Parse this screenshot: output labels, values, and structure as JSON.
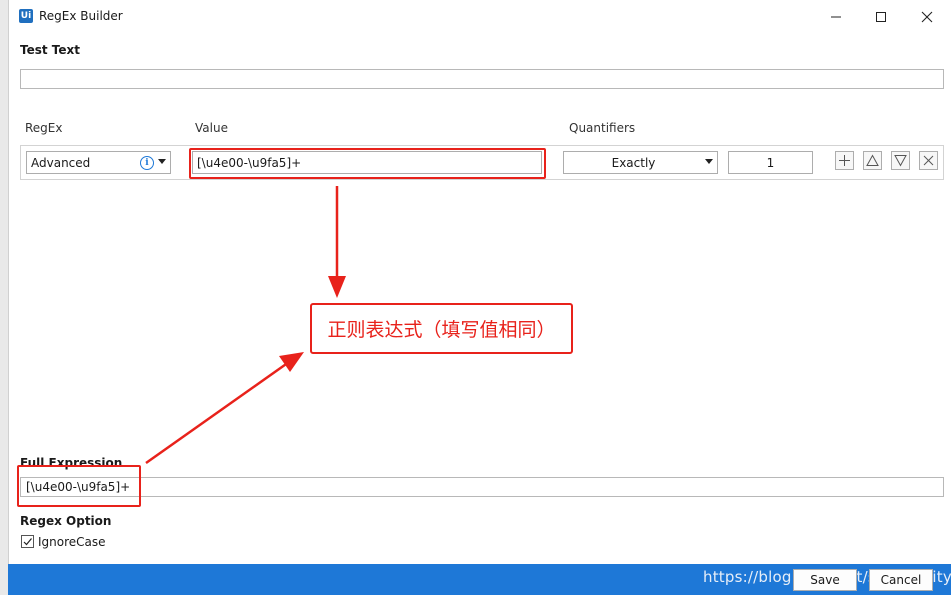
{
  "window": {
    "title": "RegEx Builder",
    "app_icon": "Ui"
  },
  "test_text": {
    "label": "Test Text",
    "value": ""
  },
  "columns": {
    "regex": "RegEx",
    "value": "Value",
    "quantifiers": "Quantifiers"
  },
  "row": {
    "regex_type": "Advanced",
    "value": "[\\u4e00-\\u9fa5]+",
    "quantifier": "Exactly",
    "count": "1"
  },
  "annotation": {
    "text": "正则表达式（填写值相同）",
    "color": "#e8221b"
  },
  "full_expression": {
    "label": "Full Expression",
    "value": "[\\u4e00-\\u9fa5]+"
  },
  "regex_option": {
    "label": "Regex Option",
    "ignore_case_label": "IgnoreCase",
    "ignore_case_checked": true
  },
  "footer": {
    "save_label": "Save",
    "cancel_label": "Cancel",
    "watermark": "https://blog.csdn.net/sinat_...lity"
  },
  "colors": {
    "accent": "#1e78d7",
    "highlight": "#e8221b"
  }
}
